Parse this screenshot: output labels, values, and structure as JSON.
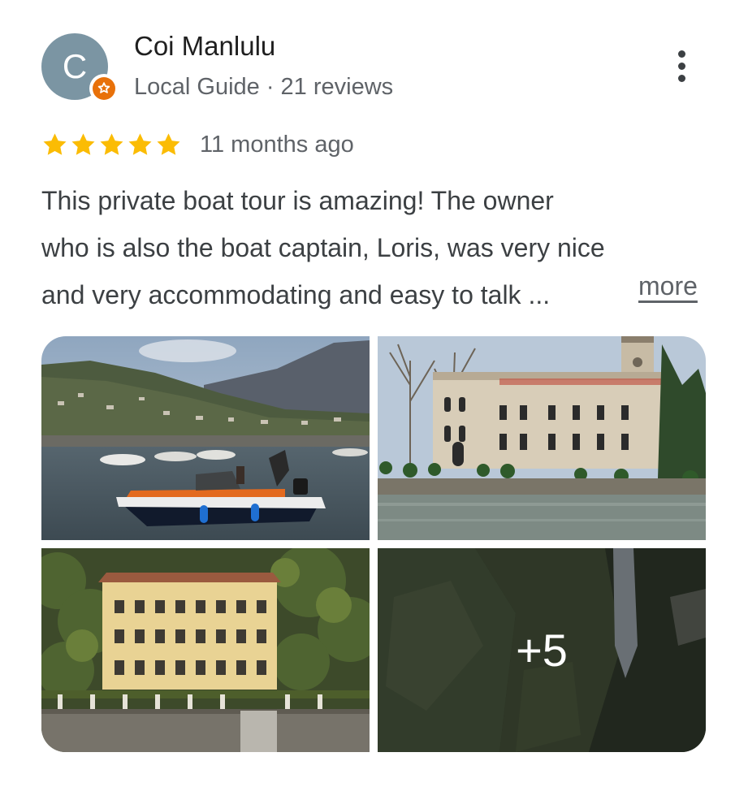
{
  "author": {
    "initial": "C",
    "name": "Coi Manlulu",
    "meta": "Local Guide · 21 reviews",
    "avatar_color": "#7b95a3",
    "badge_color": "#e8710a",
    "badge_icon": "local-guide-star-icon"
  },
  "menu": {
    "icon": "more-vert-icon"
  },
  "rating": {
    "stars": 5,
    "star_color": "#fbbc04",
    "time_ago": "11 months ago"
  },
  "review": {
    "lines": [
      "This private boat tour is amazing! The owner",
      "who is also the boat captain, Loris, was very nice",
      "and very accommodating and easy to talk ..."
    ],
    "more_label": "more"
  },
  "photos": {
    "items": [
      "boat-on-lake-photo",
      "villa-waterfront-photo",
      "yellow-villa-photo",
      "cliff-waterfall-photo"
    ],
    "more_count_label": "+5"
  }
}
